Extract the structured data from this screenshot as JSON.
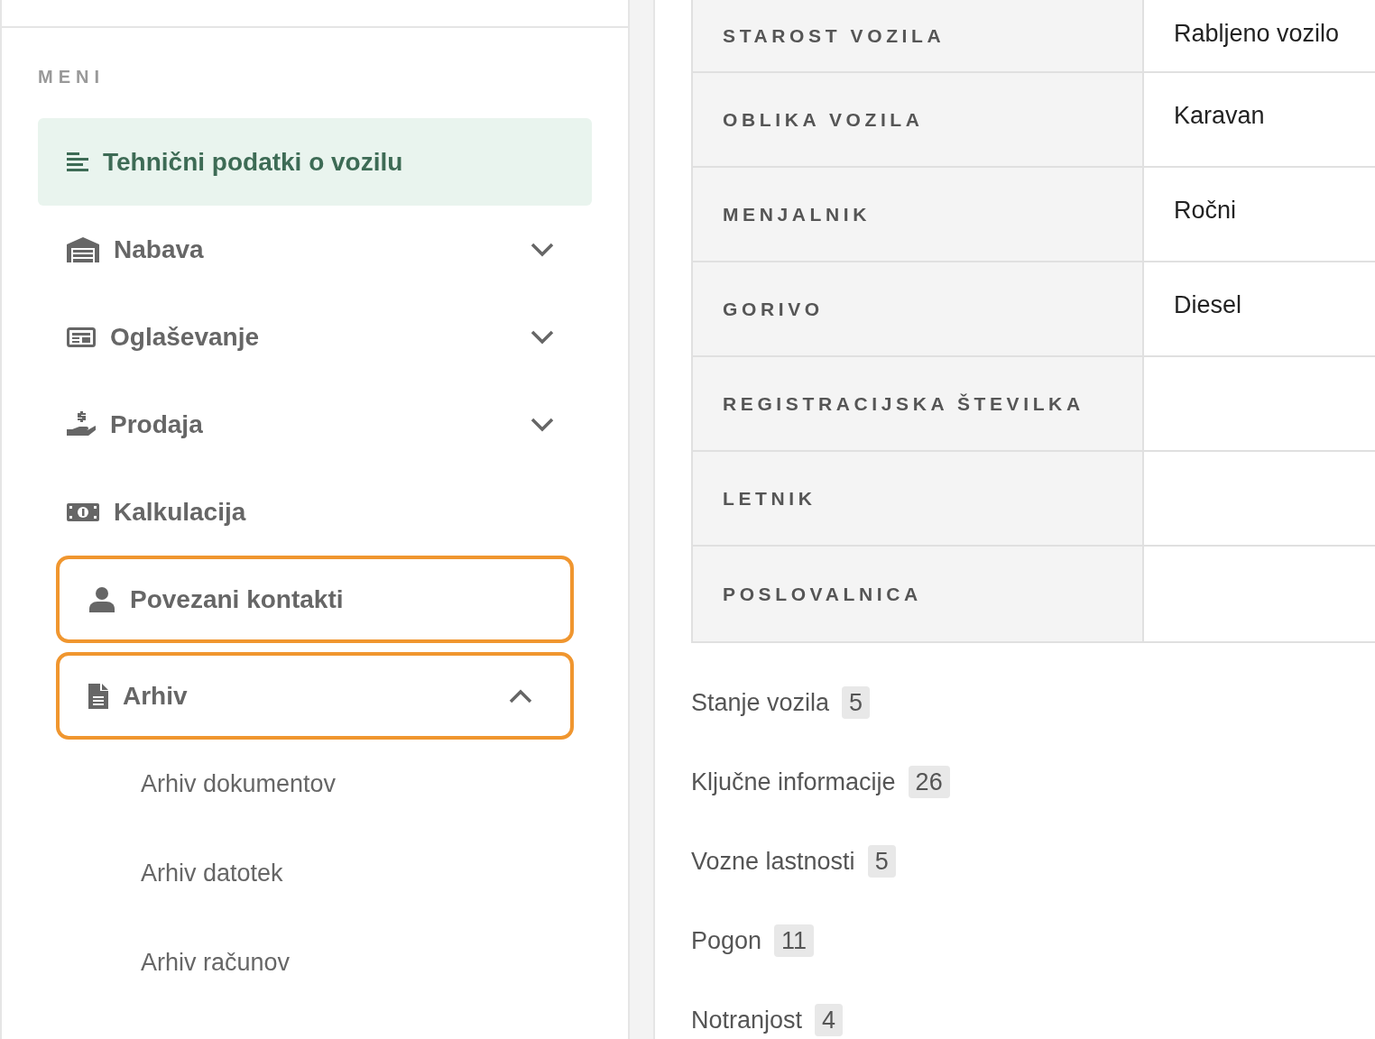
{
  "sidebar": {
    "heading": "MENI",
    "items": [
      {
        "kind": "link",
        "label": "Tehnični podatki o vozilu",
        "selected": true,
        "highlighted": false
      },
      {
        "kind": "group",
        "label": "Nabava",
        "selected": false,
        "highlighted": false,
        "expanded": false
      },
      {
        "kind": "group",
        "label": "Oglaševanje",
        "selected": false,
        "highlighted": false,
        "expanded": false
      },
      {
        "kind": "group",
        "label": "Prodaja",
        "selected": false,
        "highlighted": false,
        "expanded": false
      },
      {
        "kind": "link",
        "label": "Kalkulacija",
        "selected": false,
        "highlighted": false
      },
      {
        "kind": "link",
        "label": "Povezani kontakti",
        "selected": false,
        "highlighted": true
      },
      {
        "kind": "group",
        "label": "Arhiv",
        "selected": false,
        "highlighted": true,
        "expanded": true,
        "children": [
          {
            "label": "Arhiv dokumentov"
          },
          {
            "label": "Arhiv datotek"
          },
          {
            "label": "Arhiv računov"
          }
        ]
      }
    ]
  },
  "table": {
    "rows": [
      {
        "label": "STAROST VOZILA",
        "value": "Rabljeno vozilo"
      },
      {
        "label": "OBLIKA VOZILA",
        "value": "Karavan"
      },
      {
        "label": "MENJALNIK",
        "value": "Ročni"
      },
      {
        "label": "GORIVO",
        "value": "Diesel"
      },
      {
        "label": "REGISTRACIJSKA ŠTEVILKA"
      },
      {
        "label": "LETNIK"
      },
      {
        "label": "POSLOVALNICA"
      }
    ]
  },
  "sections": [
    {
      "label": "Stanje vozila",
      "count": "5"
    },
    {
      "label": "Ključne informacije",
      "count": "26"
    },
    {
      "label": "Vozne lastnosti",
      "count": "5"
    },
    {
      "label": "Pogon",
      "count": "11"
    },
    {
      "label": "Notranjost",
      "count": "4"
    }
  ]
}
